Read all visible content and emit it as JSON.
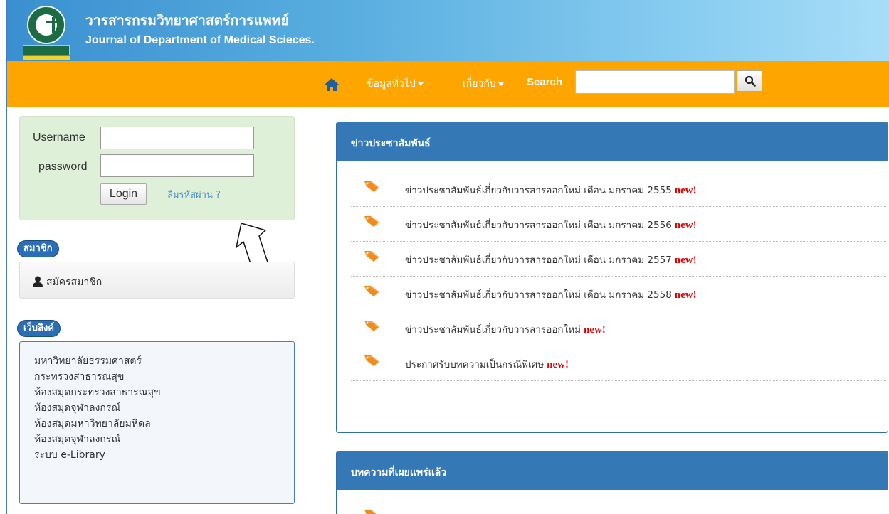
{
  "header": {
    "title_th": "วารสารกรมวิทยาศาสตร์การแพทย์",
    "title_en": "Journal of Department of Medical Scieces.",
    "logo_icon": "department-seal-logo"
  },
  "navbar": {
    "home_icon": "home-icon",
    "items": [
      {
        "label": "ข้อมูลทั่วไป"
      },
      {
        "label": "เกี่ยวกับ"
      }
    ],
    "search_label": "Search",
    "search_value": "",
    "search_icon": "magnifier-icon",
    "background_color": "#ffa500"
  },
  "login": {
    "username_label": "Username",
    "username_value": "",
    "password_label": "password",
    "password_value": "",
    "login_button": "Login",
    "forgot_link": "ลืมรหัสผ่าน ?"
  },
  "members": {
    "pill_label": "สมาชิก",
    "register_link": "สมัครสมาชิก"
  },
  "weblinks": {
    "pill_label": "เว็บลิงค์",
    "items": [
      "มหาวิทยาลัยธรรมศาสตร์",
      "กระทรวงสาธารณสุข",
      "ห้องสมุดกระทรวงสาธารณสุข",
      "ห้องสมุดจุฬาลงกรณ์",
      "ห้องสมุดมหาวิทยาลัยมหิดล",
      "ห้องสมุดจุฬาลงกรณ์",
      "ระบบ e-Library"
    ]
  },
  "news": {
    "heading": "ข่าวประชาสัมพันธ์",
    "new_badge": "new!",
    "items": [
      "ข่าวประชาสัมพันธ์เกี่ยวกับวารสารออกใหม่ เดือน มกราคม 2555",
      "ข่าวประชาสัมพันธ์เกี่ยวกับวารสารออกใหม่ เดือน มกราคม 2556",
      "ข่าวประชาสัมพันธ์เกี่ยวกับวารสารออกใหม่ เดือน มกราคม 2557",
      "ข่าวประชาสัมพันธ์เกี่ยวกับวารสารออกใหม่ เดือน มกราคม 2558",
      "ข่าวประชาสัมพันธ์เกี่ยวกับวารสารออกใหม่",
      "ประกาศรับบทความเป็นกรณีพิเศษ"
    ]
  },
  "published": {
    "heading": "บทความที่เผยแพร่แล้ว"
  },
  "colors": {
    "panel_blue": "#3478b6",
    "new_red": "#e00000",
    "tag_orange": "#f28a1c",
    "login_green": "#dff0d8"
  }
}
